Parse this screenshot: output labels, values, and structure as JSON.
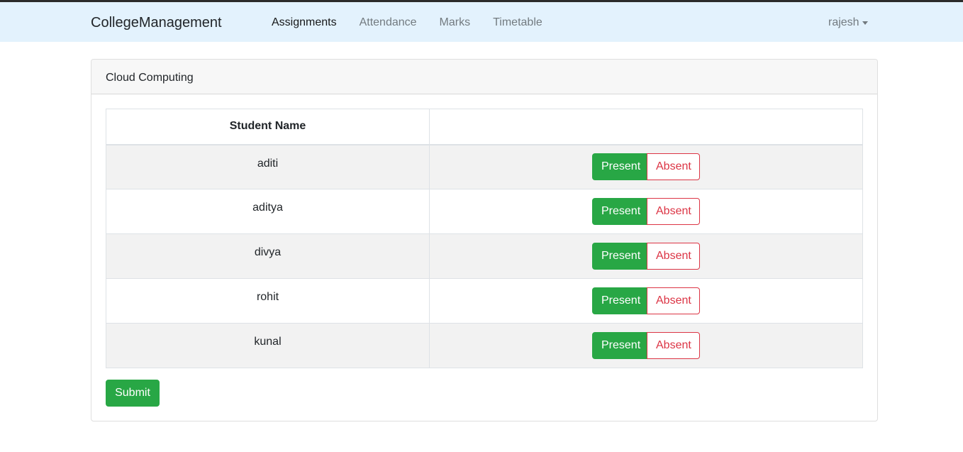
{
  "navbar": {
    "brand": "CollegeManagement",
    "links": [
      {
        "label": "Assignments",
        "active": true
      },
      {
        "label": "Attendance",
        "active": false
      },
      {
        "label": "Marks",
        "active": false
      },
      {
        "label": "Timetable",
        "active": false
      }
    ],
    "user": "rajesh"
  },
  "card": {
    "title": "Cloud Computing",
    "table": {
      "headers": [
        "Student Name",
        ""
      ],
      "rows": [
        {
          "name": "aditi",
          "present_label": "Present",
          "absent_label": "Absent"
        },
        {
          "name": "aditya",
          "present_label": "Present",
          "absent_label": "Absent"
        },
        {
          "name": "divya",
          "present_label": "Present",
          "absent_label": "Absent"
        },
        {
          "name": "rohit",
          "present_label": "Present",
          "absent_label": "Absent"
        },
        {
          "name": "kunal",
          "present_label": "Present",
          "absent_label": "Absent"
        }
      ]
    },
    "submit_label": "Submit"
  },
  "colors": {
    "navbar_bg": "#e3f2fd",
    "success": "#28a745",
    "danger": "#dc3545"
  }
}
